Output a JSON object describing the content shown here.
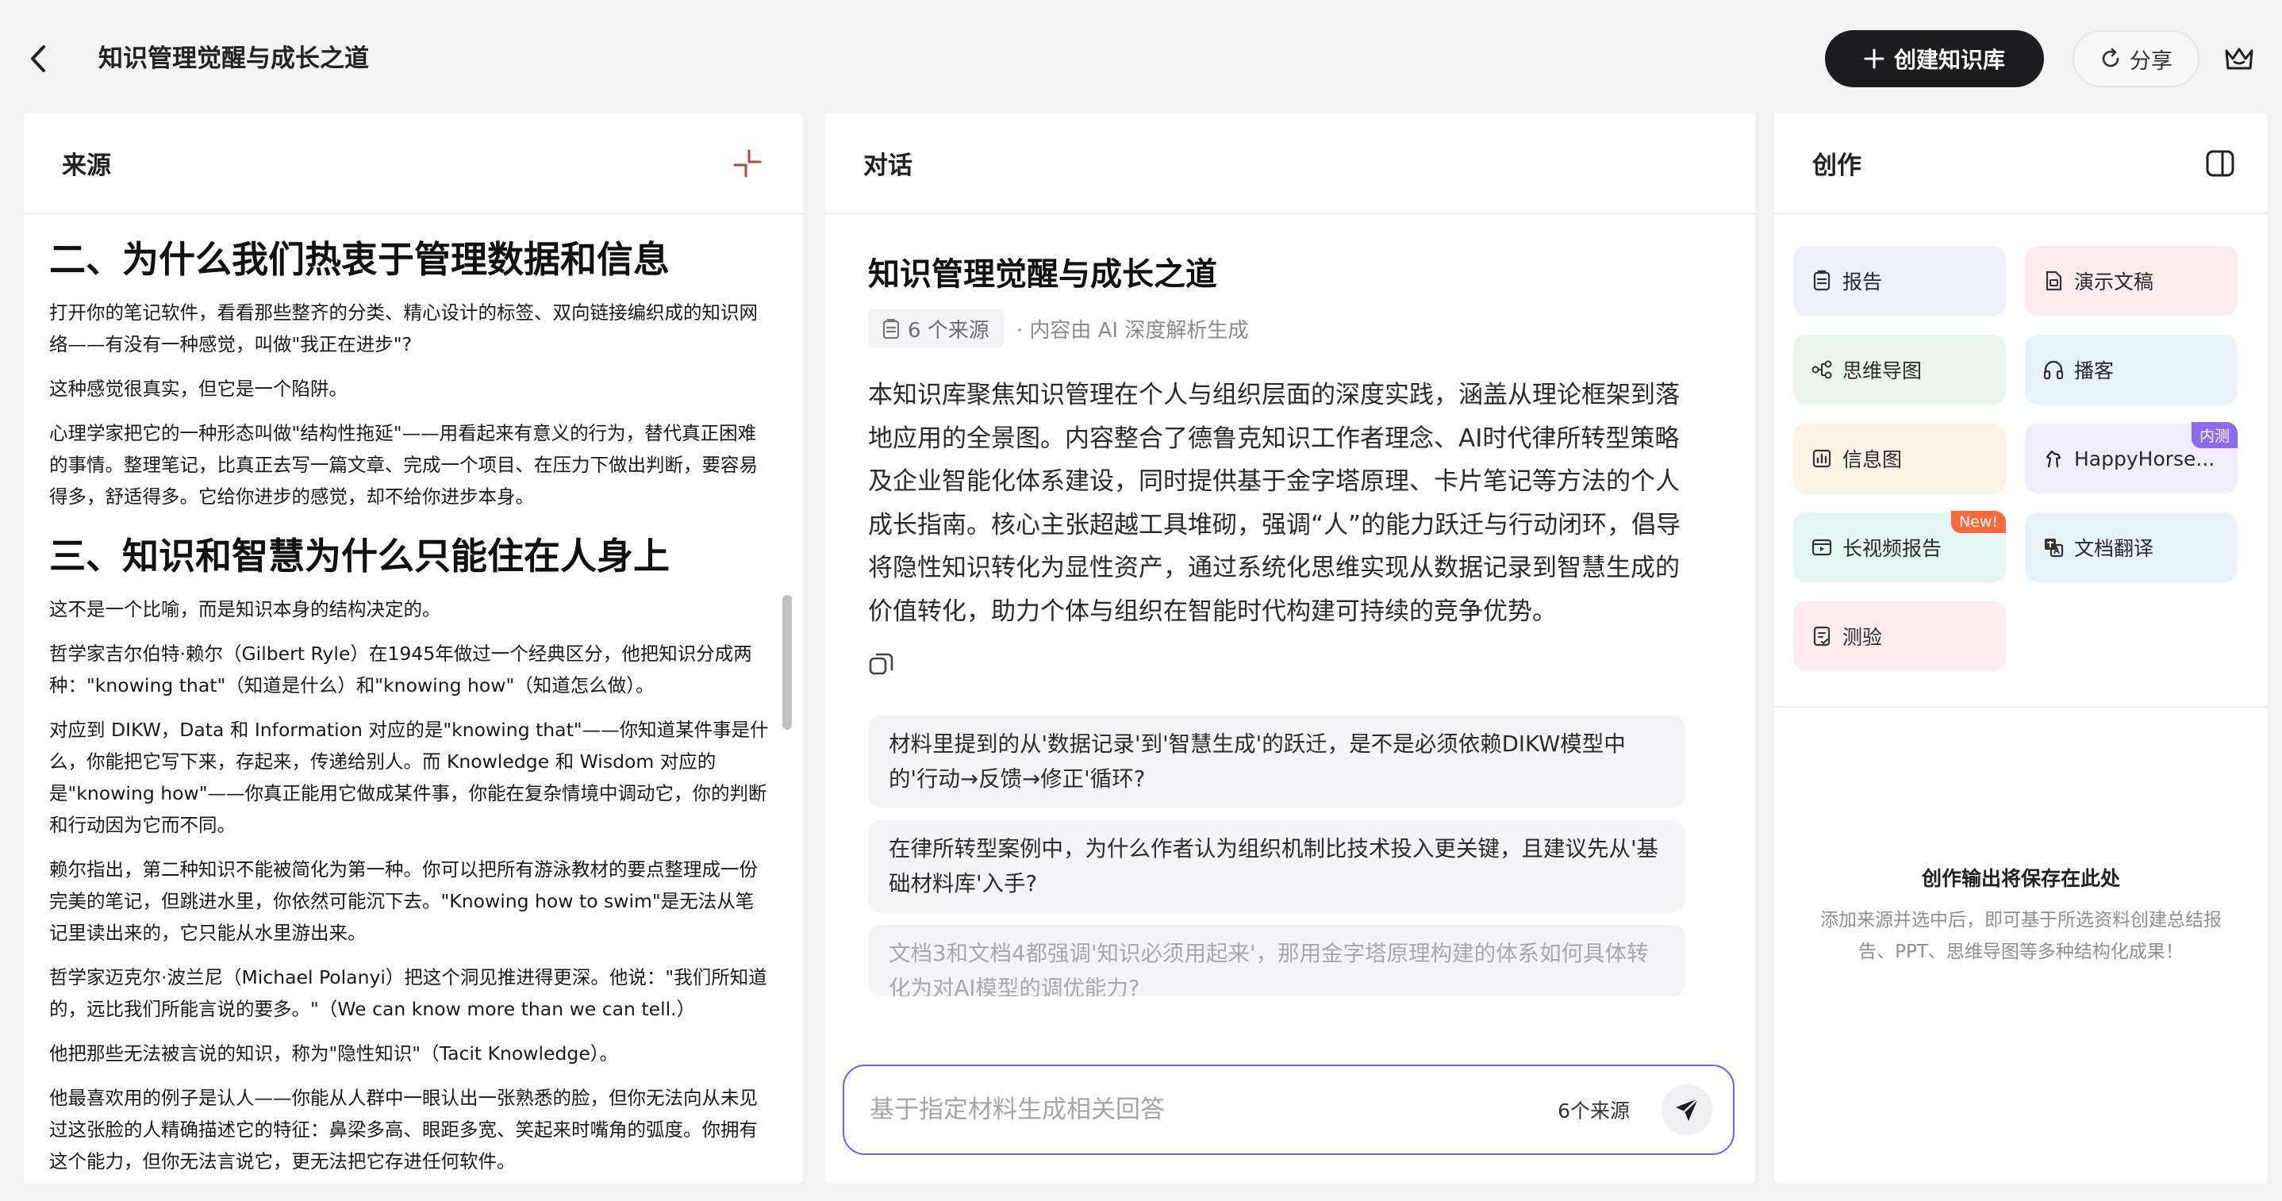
{
  "header": {
    "title": "知识管理觉醒与成长之道",
    "create_label": "创建知识库",
    "share_label": "分享"
  },
  "sources": {
    "title": "来源",
    "h2_1": "二、为什么我们热衷于管理数据和信息",
    "p1": "打开你的笔记软件，看看那些整齐的分类、精心设计的标签、双向链接编织成的知识网络——有没有一种感觉，叫做\"我正在进步\"?",
    "p2": "这种感觉很真实，但它是一个陷阱。",
    "p3": "心理学家把它的一种形态叫做\"结构性拖延\"——用看起来有意义的行为，替代真正困难的事情。整理笔记，比真正去写一篇文章、完成一个项目、在压力下做出判断，要容易得多，舒适得多。它给你进步的感觉，却不给你进步本身。",
    "h2_2": "三、知识和智慧为什么只能住在人身上",
    "p4": "这不是一个比喻，而是知识本身的结构决定的。",
    "p5": "哲学家吉尔伯特·赖尔（Gilbert Ryle）在1945年做过一个经典区分，他把知识分成两种：\"knowing that\"（知道是什么）和\"knowing how\"（知道怎么做）。",
    "p6": "对应到 DIKW，Data 和 Information 对应的是\"knowing that\"——你知道某件事是什么，你能把它写下来，存起来，传递给别人。而 Knowledge 和 Wisdom 对应的是\"knowing how\"——你真正能用它做成某件事，你能在复杂情境中调动它，你的判断和行动因为它而不同。",
    "p7": "赖尔指出，第二种知识不能被简化为第一种。你可以把所有游泳教材的要点整理成一份完美的笔记，但跳进水里，你依然可能沉下去。\"Knowing how to swim\"是无法从笔记里读出来的，它只能从水里游出来。",
    "p8": "哲学家迈克尔·波兰尼（Michael Polanyi）把这个洞见推进得更深。他说：\"我们所知道的，远比我们所能言说的要多。\"（We can know more than we can tell.）",
    "p9": "他把那些无法被言说的知识，称为\"隐性知识\"（Tacit Knowledge）。",
    "p10": "他最喜欢用的例子是认人——你能从人群中一眼认出一张熟悉的脸，但你无法向从未见过这张脸的人精确描述它的特征：鼻梁多高、眼距多宽、笑起来时嘴角的弧度。你拥有这个能力，但你无法言说它，更无法把它存进任何软件。"
  },
  "dialog": {
    "title": "对话",
    "kb_title": "知识管理觉醒与成长之道",
    "source_chip": "6 个来源",
    "meta": "· 内容由 AI 深度解析生成",
    "summary": "本知识库聚焦知识管理在个人与组织层面的深度实践，涵盖从理论框架到落地应用的全景图。内容整合了德鲁克知识工作者理念、AI时代律所转型策略及企业智能化体系建设，同时提供基于金字塔原理、卡片笔记等方法的个人成长指南。核心主张超越工具堆砌，强调“人”的能力跃迁与行动闭环，倡导将隐性知识转化为显性资产，通过系统化思维实现从数据记录到智慧生成的价值转化，助力个体与组织在智能时代构建可持续的竞争优势。",
    "suggestions": [
      "材料里提到的从'数据记录'到'智慧生成'的跃迁，是不是必须依赖DIKW模型中的'行动→反馈→修正'循环?",
      "在律所转型案例中，为什么作者认为组织机制比技术投入更关键，且建议先从'基础材料库'入手?",
      "文档3和文档4都强调'知识必须用起来'，那用金字塔原理构建的体系如何具体转化为对AI模型的调优能力?"
    ],
    "input_placeholder": "基于指定材料生成相关回答",
    "input_value": "",
    "source_count": "6个来源"
  },
  "create": {
    "title": "创作",
    "tools": [
      {
        "label": "报告",
        "icon": "report-icon",
        "bg": "#eef0fb"
      },
      {
        "label": "演示文稿",
        "icon": "slides-icon",
        "bg": "#fdecef"
      },
      {
        "label": "思维导图",
        "icon": "mindmap-icon",
        "bg": "#e9f6ee"
      },
      {
        "label": "播客",
        "icon": "headphones-icon",
        "bg": "#e6f3fb"
      },
      {
        "label": "信息图",
        "icon": "infographic-icon",
        "bg": "#fcf3e6"
      },
      {
        "label": "HappyHorse...",
        "icon": "horse-icon",
        "bg": "#efecfb",
        "badge": "内测",
        "badge_color": "#8b6cf0"
      },
      {
        "label": "长视频报告",
        "icon": "video-icon",
        "bg": "#e4f6f1",
        "badge": "New!",
        "badge_color": "#ff6a3d"
      },
      {
        "label": "文档翻译",
        "icon": "translate-icon",
        "bg": "#e6f3fb"
      },
      {
        "label": "测验",
        "icon": "quiz-icon",
        "bg": "#fdecef"
      }
    ],
    "empty_title": "创作输出将保存在此处",
    "empty_desc": "添加来源并选中后，即可基于所选资料创建总结报告、PPT、思维导图等多种结构化成果！"
  }
}
